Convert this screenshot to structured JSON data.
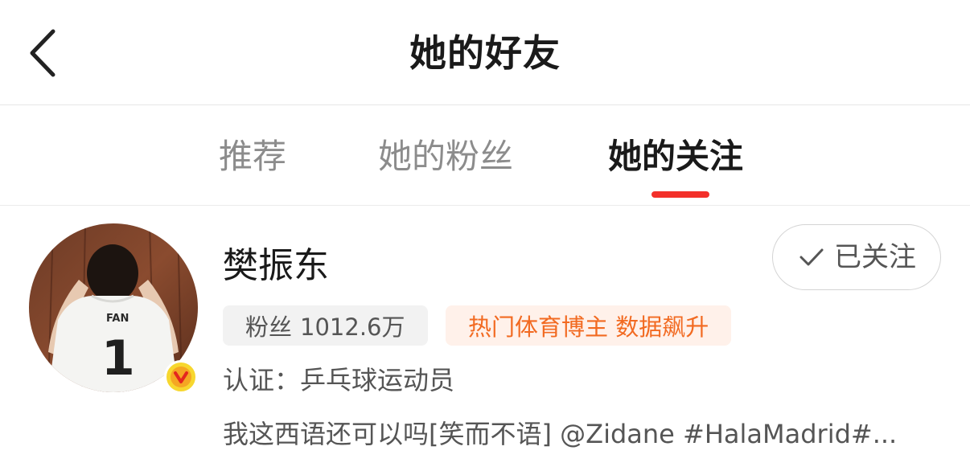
{
  "header": {
    "title": "她的好友",
    "back_icon": "chevron-left-icon"
  },
  "tabs": [
    {
      "label": "推荐",
      "active": false
    },
    {
      "label": "她的粉丝",
      "active": false
    },
    {
      "label": "她的关注",
      "active": true
    }
  ],
  "user": {
    "name": "樊振东",
    "follow_label": "已关注",
    "follow_icon": "check-icon",
    "fans_label": "粉丝",
    "fans_value": "1012.6万",
    "tag": "热门体育博主 数据飙升",
    "verification": "认证：乒乓球运动员",
    "bio": "我这西语还可以吗[笑而不语] @Zidane #HalaMadrid#...",
    "avatar_jersey_name": "FAN",
    "avatar_jersey_number": "1",
    "verified_badge": "V"
  },
  "colors": {
    "accent": "#f3302a",
    "tag_text": "#f26a21",
    "tag_bg": "#fff1ea",
    "verified": "#f7d72f"
  }
}
